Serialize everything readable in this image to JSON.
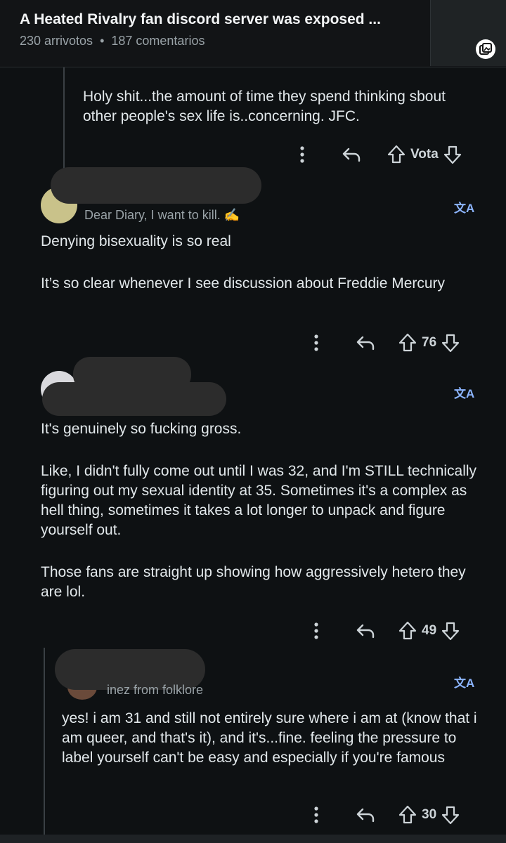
{
  "header": {
    "title": "A Heated Rivalry fan discord server was exposed ...",
    "upvotes": "230 arrivotos",
    "separator": "•",
    "comments": "187 comentarios",
    "thumbnail_icon": "gallery-icon"
  },
  "comments": [
    {
      "text": [
        "Holy shit...the amount of time they spend thinking sbout other people's sex life is..concerning. JFC."
      ],
      "vote_label": "Vota"
    },
    {
      "flair": "Dear Diary, I want to kill. ✍",
      "text": [
        "Denying bisexuality is so real",
        "It’s so clear whenever I see discussion about Freddie Mercury"
      ],
      "votes": "76"
    },
    {
      "text": [
        "It's genuinely so fucking gross.",
        "Like, I didn't fully come out until I was 32, and I'm STILL technically figuring out my sexual identity at 35. Sometimes it's a complex as hell thing, sometimes it takes a lot longer to unpack and figure yourself out.",
        "Those fans are straight up showing how aggressively hetero they are lol."
      ],
      "votes": "49"
    },
    {
      "flair": "inez from folklore",
      "text": [
        "yes! i am 31 and still not entirely sure where i am at (know that i am queer, and that's it), and it's...fine. feeling the pressure to label yourself can't be easy and especially if you're famous"
      ],
      "votes": "30"
    }
  ],
  "icons": {
    "more": "more-vertical-icon",
    "reply": "reply-icon",
    "upvote": "upvote-arrow-icon",
    "downvote": "downvote-arrow-icon",
    "translate": "translate-icon"
  },
  "translate_glyph": "文A",
  "colors": {
    "background": "#0e1113",
    "text": "#e2e8eb",
    "muted": "#9aa3a8",
    "translate": "#8cb5ff"
  }
}
